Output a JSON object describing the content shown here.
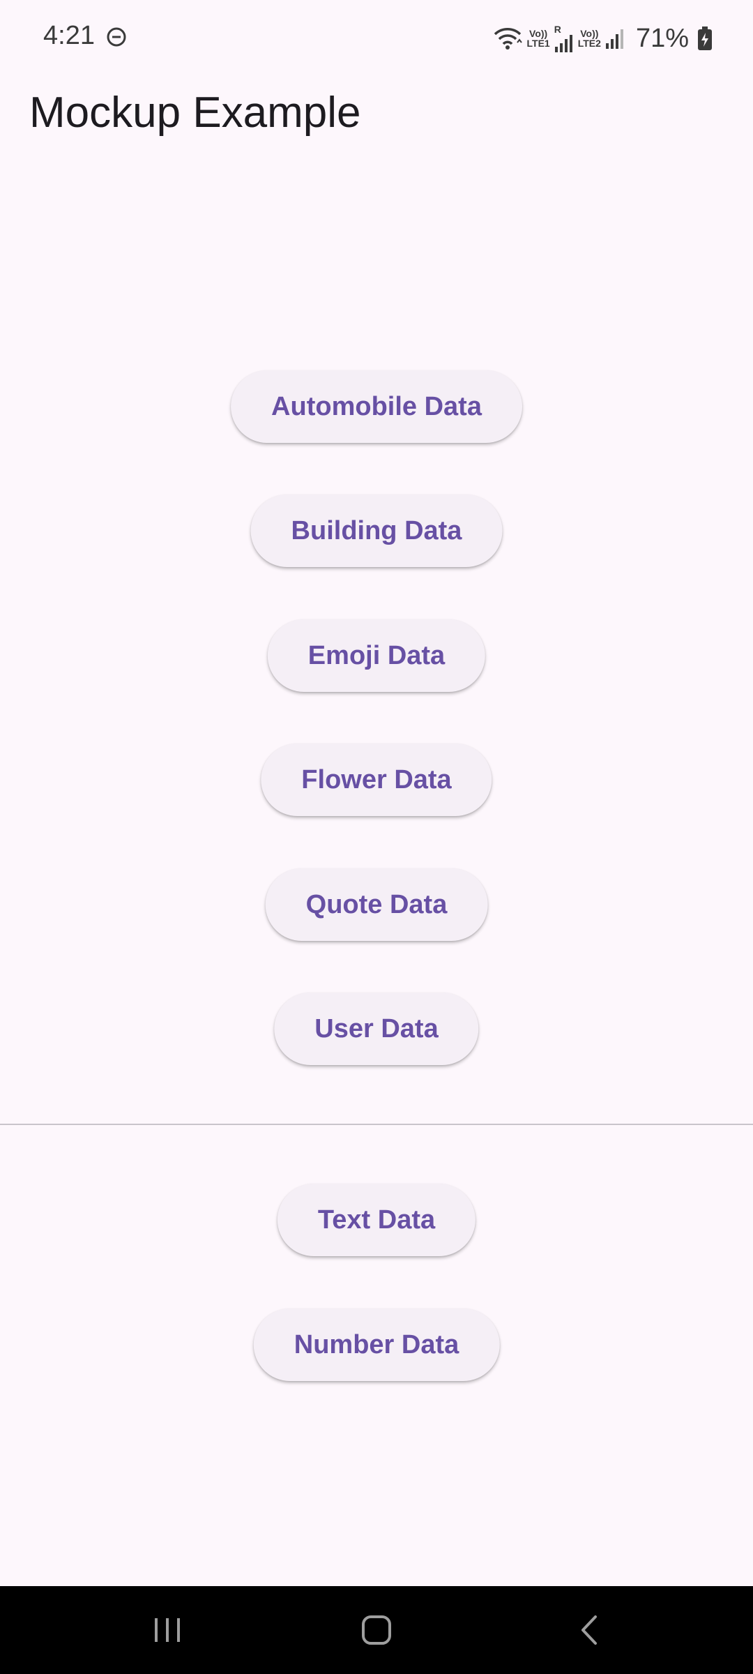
{
  "status_bar": {
    "time": "4:21",
    "battery": "71%",
    "sim1_label_top": "Vo))",
    "sim1_label_bottom": "LTE1",
    "sim2_label_top": "Vo))",
    "sim2_label_bottom": "LTE2",
    "roaming": "R",
    "icons": [
      "do-not-disturb-icon",
      "wifi-icon",
      "signal-icon",
      "battery-charging-icon"
    ]
  },
  "app_bar": {
    "title": "Mockup Example"
  },
  "buttons": {
    "automobile": "Automobile Data",
    "building": "Building Data",
    "emoji": "Emoji Data",
    "flower": "Flower Data",
    "quote": "Quote Data",
    "user": "User Data",
    "text": "Text Data",
    "number": "Number Data"
  },
  "colors": {
    "background": "#fdf7fc",
    "button_background": "#f5eff6",
    "button_text": "#6750a4",
    "divider": "#c9c4cb",
    "nav_bar": "#000000"
  },
  "nav_bar": {
    "icons": [
      "recents-icon",
      "home-icon",
      "back-icon"
    ]
  }
}
